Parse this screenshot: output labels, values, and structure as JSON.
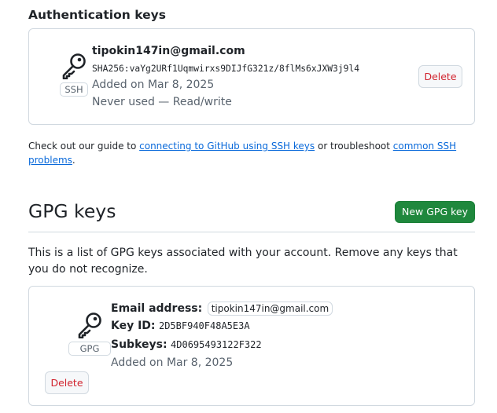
{
  "auth": {
    "title": "Authentication keys",
    "key": {
      "type_label": "SSH",
      "email": "tipokin147in@gmail.com",
      "fingerprint": "SHA256:vaYg2URf1Uqmwirxs9DIJfG321z/8flMs6xJXW3j9l4",
      "added": "Added on Mar 8, 2025",
      "usage": "Never used — Read/write",
      "delete_label": "Delete"
    },
    "guide": {
      "prefix": "Check out our guide to ",
      "link1": "connecting to GitHub using SSH keys",
      "middle": " or troubleshoot ",
      "link2": "common SSH problems",
      "suffix": "."
    }
  },
  "gpg": {
    "title": "GPG keys",
    "new_button": "New GPG key",
    "description": "This is a list of GPG keys associated with your account. Remove any keys that you do not recognize.",
    "key": {
      "type_label": "GPG",
      "email_label": "Email address:",
      "email": "tipokin147in@gmail.com",
      "keyid_label": "Key ID:",
      "keyid": "2D5BF940F48A5E3A",
      "subkeys_label": "Subkeys:",
      "subkeys": "4D0695493122F322",
      "added": "Added on Mar 8, 2025",
      "delete_label": "Delete"
    }
  },
  "colors": {
    "primary_green": "#1f883d",
    "danger_red": "#d1242f",
    "link_blue": "#0969da",
    "border": "#d1d9e0",
    "muted_text": "#59636e"
  },
  "icons": {
    "ssh_key": "key-icon",
    "gpg_key": "key-icon"
  }
}
